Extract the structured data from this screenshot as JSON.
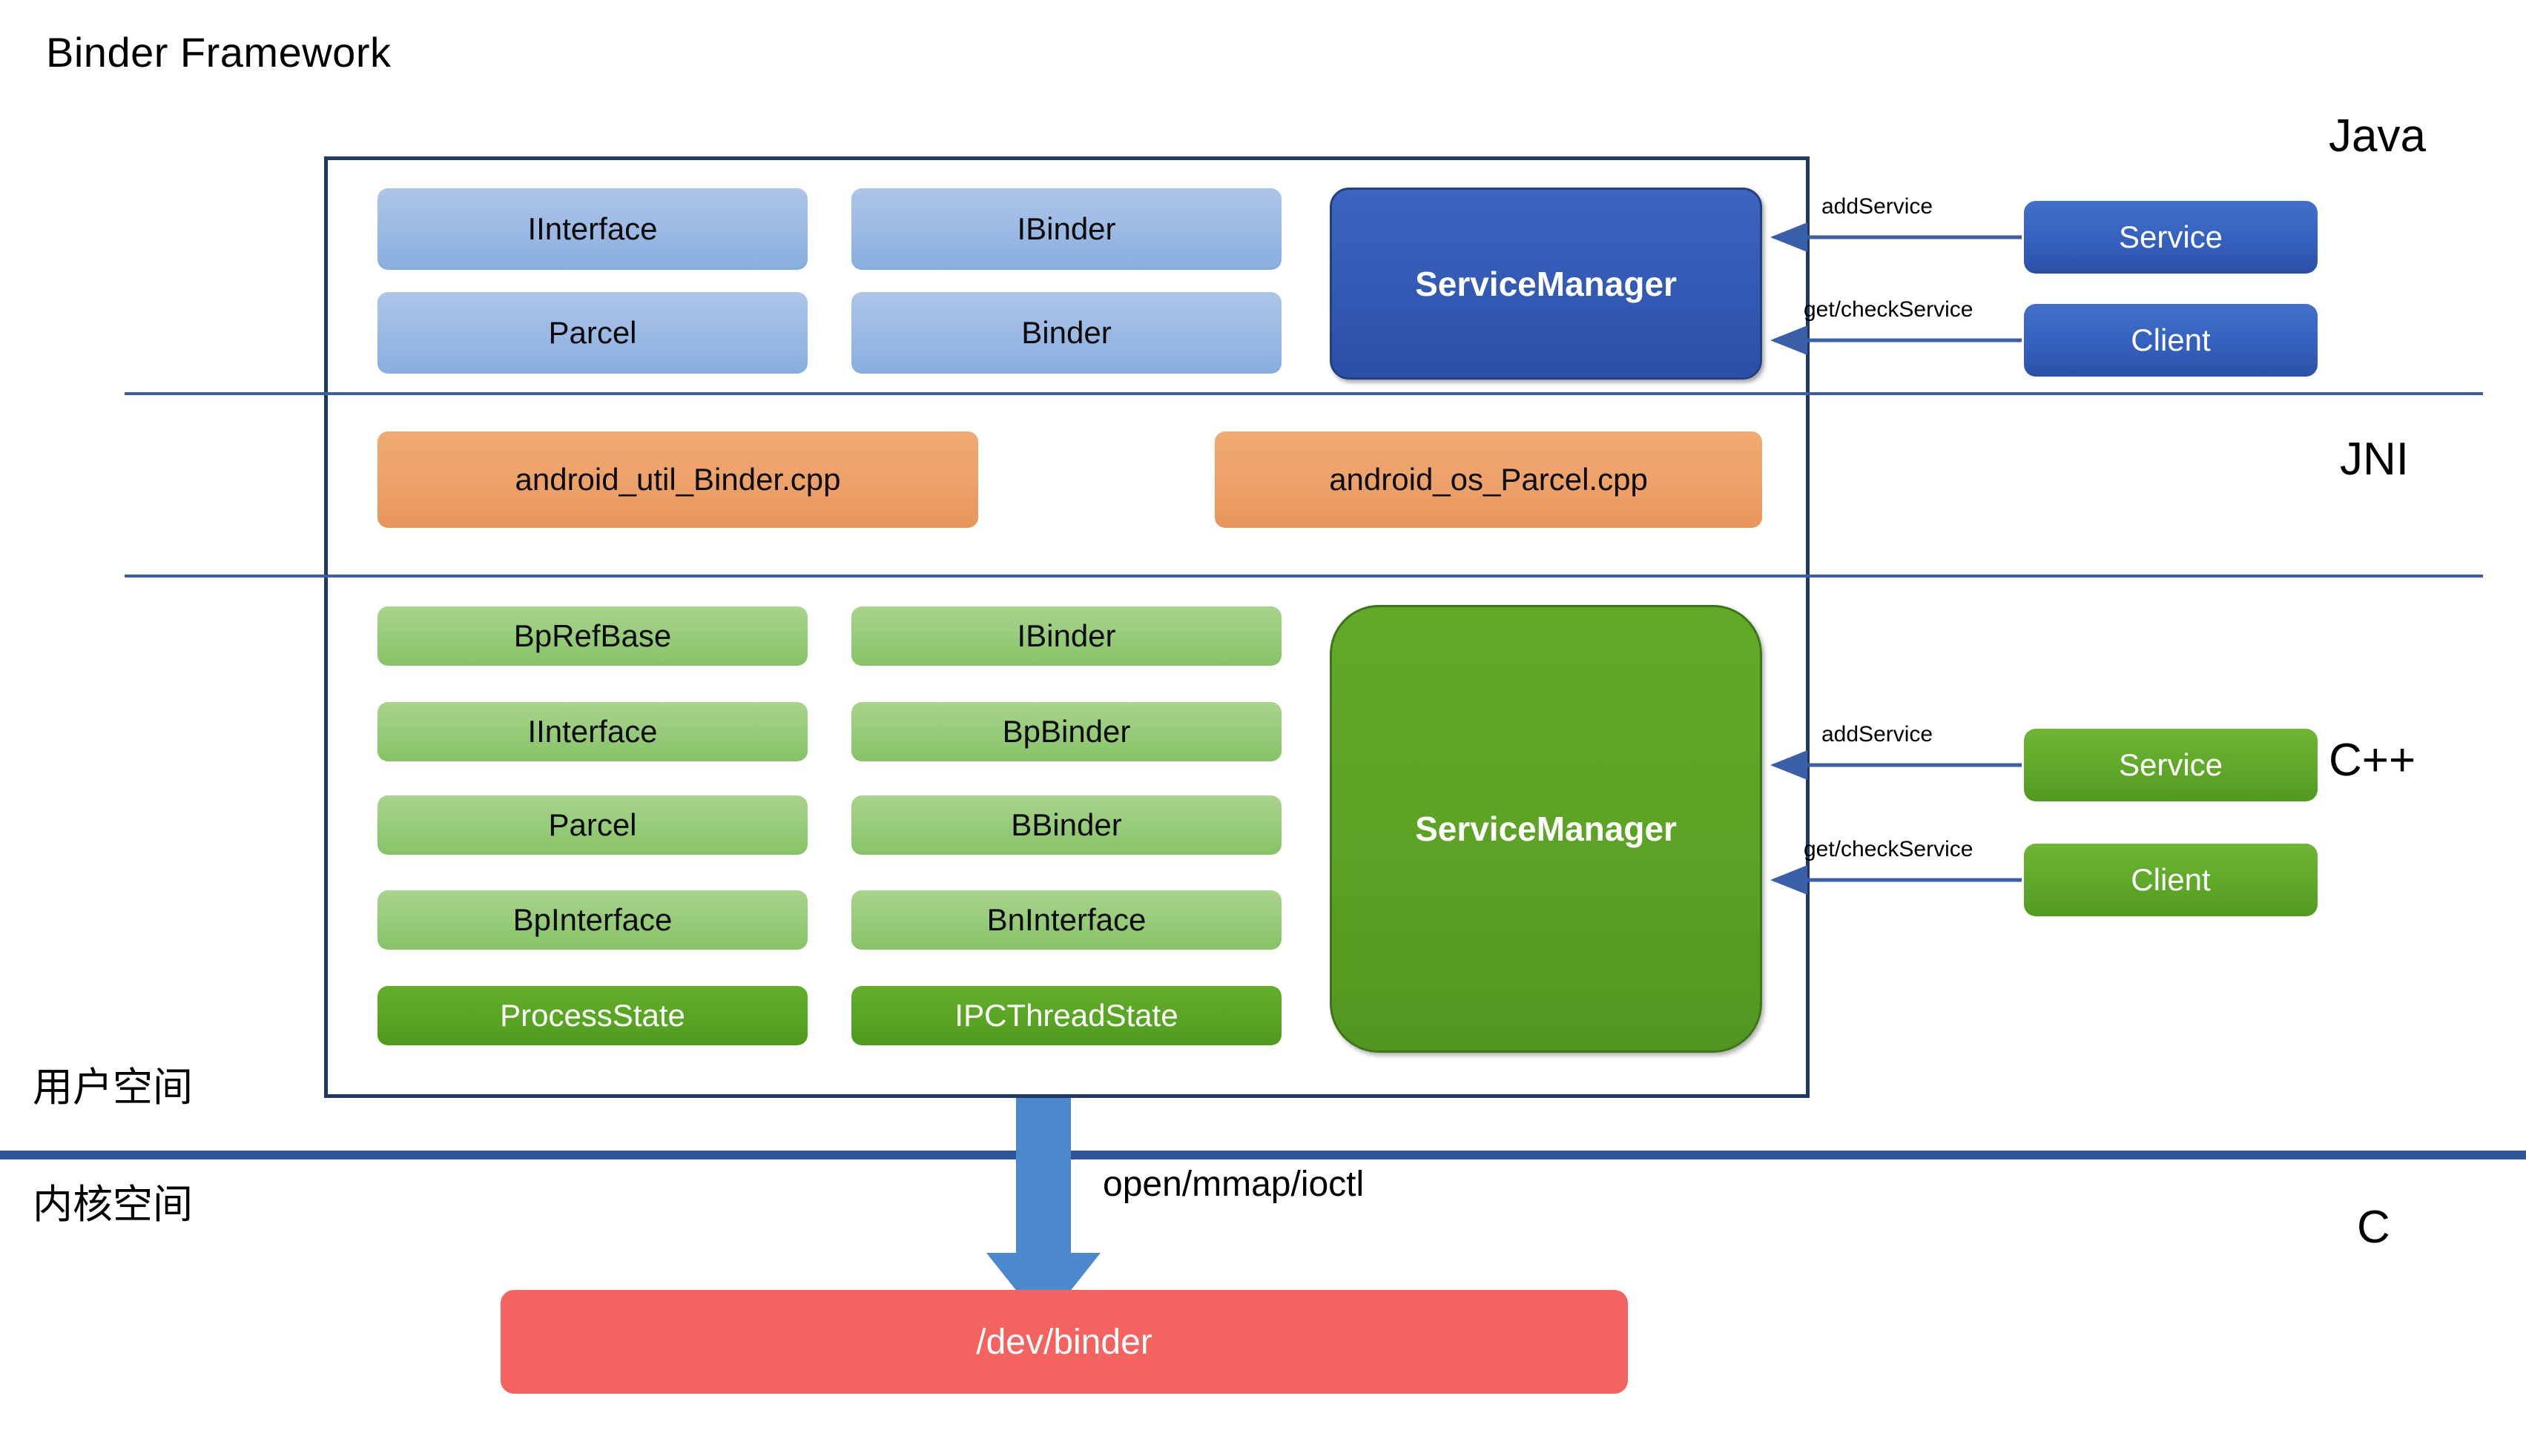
{
  "title": "Binder Framework",
  "layer_labels": {
    "java": "Java",
    "jni": "JNI",
    "cpp": "C++",
    "c": "C"
  },
  "space_labels": {
    "user": "用户空间",
    "kernel": "内核空间"
  },
  "java_layer": {
    "chips_left": [
      "IInterface",
      "Parcel"
    ],
    "chips_right": [
      "IBinder",
      "Binder"
    ],
    "service_manager": "ServiceManager",
    "actors": [
      {
        "label": "Service",
        "arrow_label": "addService"
      },
      {
        "label": "Client",
        "arrow_label": "get/checkService"
      }
    ]
  },
  "jni_layer": {
    "chips": [
      "android_util_Binder.cpp",
      "android_os_Parcel.cpp"
    ]
  },
  "cpp_layer": {
    "chips_left": [
      "BpRefBase",
      "IInterface",
      "Parcel",
      "BpInterface",
      "ProcessState"
    ],
    "chips_right": [
      "IBinder",
      "BpBinder",
      "BBinder",
      "BnInterface",
      "IPCThreadState"
    ],
    "service_manager": "ServiceManager",
    "actors": [
      {
        "label": "Service",
        "arrow_label": "addService"
      },
      {
        "label": "Client",
        "arrow_label": "get/checkService"
      }
    ]
  },
  "kernel_layer": {
    "syscall_label": "open/mmap/ioctl",
    "device_node": "/dev/binder"
  },
  "colors": {
    "frame_border": "#1F3864",
    "divider": "#3B5EA8",
    "kernel_divider": "#2E5597",
    "java_chip": "#9DBBE4",
    "jni_chip": "#ECA067",
    "cpp_chip": "#97CC7A",
    "cpp_chip_dark": "#58A423",
    "java_accent": "#3259B4",
    "cpp_accent": "#5CA224",
    "device_node": "#F4635F",
    "arrow": "#3B5EA8",
    "block_arrow": "#4B88CE"
  }
}
